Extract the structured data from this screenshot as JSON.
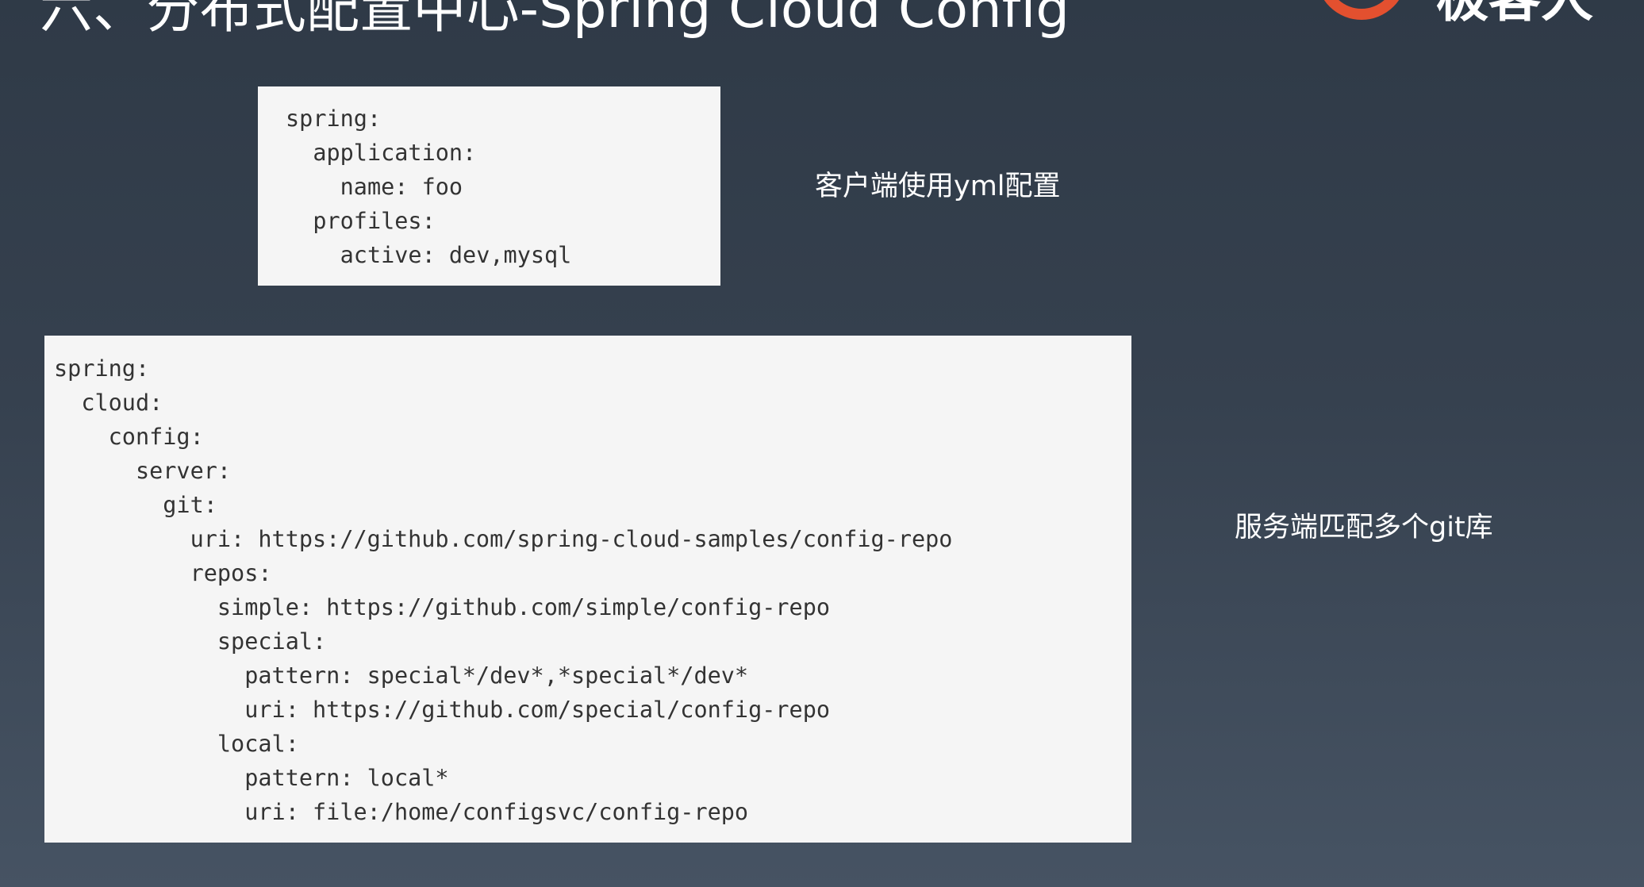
{
  "slide": {
    "title": "六、分布式配置中心-Spring Cloud Config",
    "brand_text": "极客人",
    "brand_icon": "ring-logo-icon",
    "brand_color": "#e3502f"
  },
  "client_config": {
    "caption": "客户端使用yml配置",
    "lines": [
      "spring:",
      "  application:",
      "    name: foo",
      "  profiles:",
      "    active: dev,mysql"
    ]
  },
  "server_config": {
    "caption": "服务端匹配多个git库",
    "lines": [
      "spring:",
      "  cloud:",
      "    config:",
      "      server:",
      "        git:",
      "          uri: https://github.com/spring-cloud-samples/config-repo",
      "          repos:",
      "            simple: https://github.com/simple/config-repo",
      "            special:",
      "              pattern: special*/dev*,*special*/dev*",
      "              uri: https://github.com/special/config-repo",
      "            local:",
      "              pattern: local*",
      "              uri: file:/home/configsvc/config-repo"
    ]
  }
}
